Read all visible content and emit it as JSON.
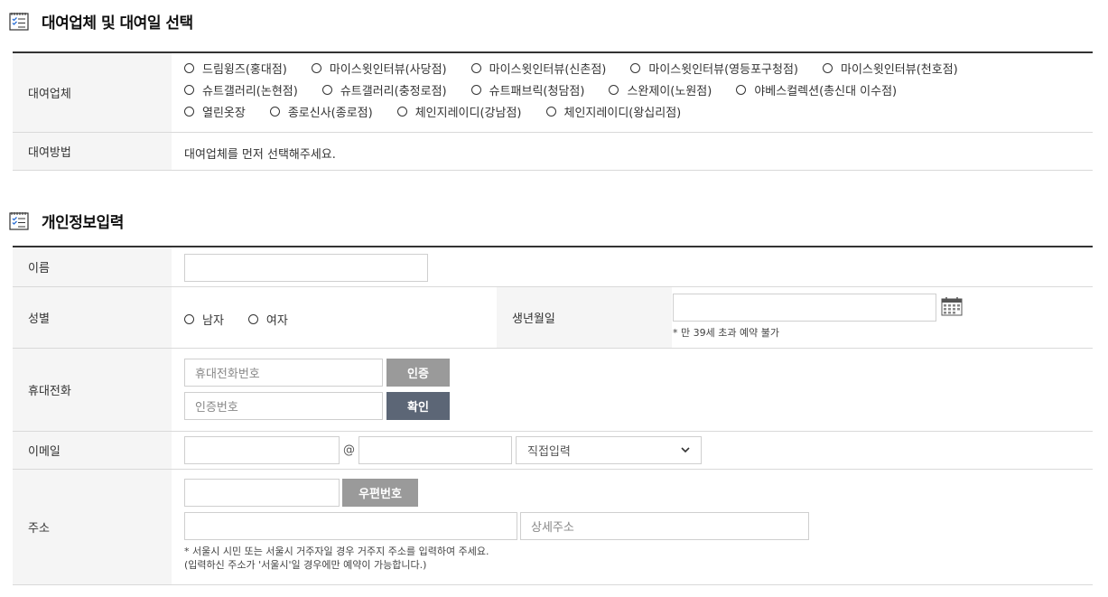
{
  "section1": {
    "title": "대여업체 및 대여일 선택",
    "rows": {
      "company_label": "대여업체",
      "method_label": "대여방법",
      "method_text": "대여업체를 먼저 선택해주세요."
    },
    "companies": [
      [
        "드림윙즈(홍대점)",
        "마이스윗인터뷰(사당점)",
        "마이스윗인터뷰(신촌점)",
        "마이스윗인터뷰(영등포구청점)",
        "마이스윗인터뷰(천호점)"
      ],
      [
        "슈트갤러리(논현점)",
        "슈트갤러리(충정로점)",
        "슈트패브릭(청담점)",
        "스완제이(노원점)",
        "야베스컬렉션(총신대 이수점)"
      ],
      [
        "열린옷장",
        "종로신사(종로점)",
        "체인지레이디(강남점)",
        "체인지레이디(왕십리점)"
      ]
    ]
  },
  "section2": {
    "title": "개인정보입력",
    "name_label": "이름",
    "gender_label": "성별",
    "gender_male": "남자",
    "gender_female": "여자",
    "birth_label": "생년월일",
    "birth_note": "* 만 39세 초과 예약 불가",
    "phone_label": "휴대전화",
    "phone_placeholder": "휴대전화번호",
    "auth_button": "인증",
    "code_placeholder": "인증번호",
    "confirm_button": "확인",
    "email_label": "이메일",
    "email_at": "@",
    "email_select": "직접입력",
    "address_label": "주소",
    "postcode_button": "우편번호",
    "detail_placeholder": "상세주소",
    "address_note1": "* 서울시 시민 또는 서울시 거주자일 경우 거주지 주소를 입력하여 주세요.",
    "address_note2": "(입력하신 주소가 '서울시'일 경우에만 예약이 가능합니다.)"
  },
  "colors": {
    "header_line": "#333333",
    "th_bg": "#f5f5f5",
    "btn_gray": "#9a9a9a",
    "btn_dark": "#5c6676"
  }
}
